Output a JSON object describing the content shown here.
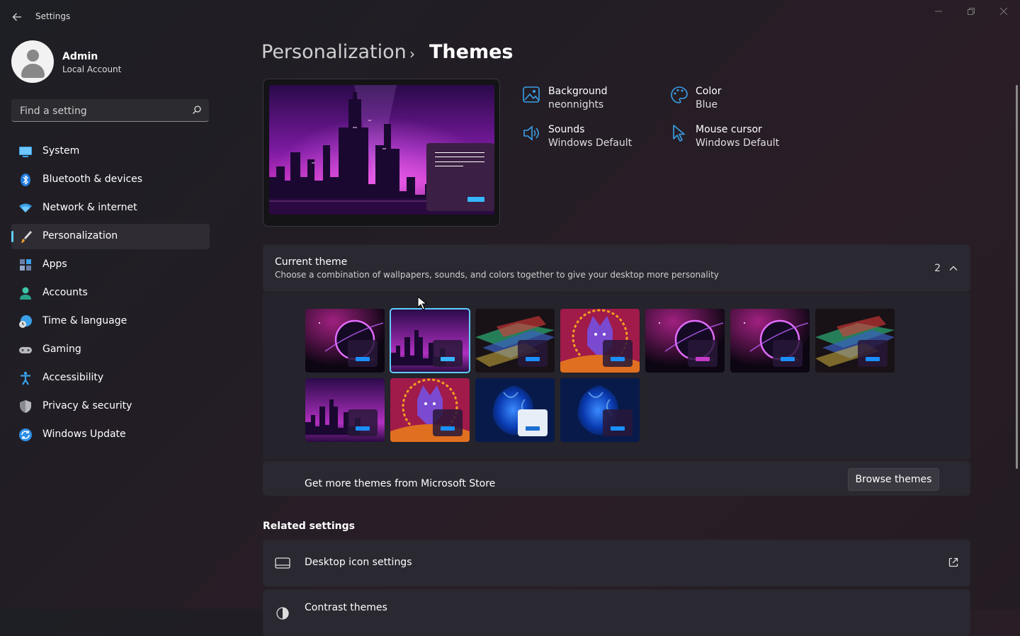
{
  "window": {
    "title": "Settings"
  },
  "user": {
    "name": "Admin",
    "account_type": "Local Account"
  },
  "search": {
    "placeholder": "Find a setting"
  },
  "sidebar": {
    "items": [
      {
        "label": "System",
        "icon": "monitor-icon"
      },
      {
        "label": "Bluetooth & devices",
        "icon": "bluetooth-icon"
      },
      {
        "label": "Network & internet",
        "icon": "wifi-icon"
      },
      {
        "label": "Personalization",
        "icon": "brush-icon",
        "active": true
      },
      {
        "label": "Apps",
        "icon": "apps-icon"
      },
      {
        "label": "Accounts",
        "icon": "person-icon"
      },
      {
        "label": "Time & language",
        "icon": "globe-clock-icon"
      },
      {
        "label": "Gaming",
        "icon": "gamepad-icon"
      },
      {
        "label": "Accessibility",
        "icon": "accessibility-icon"
      },
      {
        "label": "Privacy & security",
        "icon": "shield-icon"
      },
      {
        "label": "Windows Update",
        "icon": "update-icon"
      }
    ]
  },
  "breadcrumb": {
    "parent": "Personalization",
    "separator": "›",
    "current": "Themes"
  },
  "theme_properties": [
    {
      "label": "Background",
      "value": "neonnights",
      "icon": "picture-icon"
    },
    {
      "label": "Color",
      "value": "Blue",
      "icon": "palette-icon"
    },
    {
      "label": "Sounds",
      "value": "Windows Default",
      "icon": "speaker-icon"
    },
    {
      "label": "Mouse cursor",
      "value": "Windows Default",
      "icon": "cursor-icon"
    }
  ],
  "current_theme": {
    "title": "Current theme",
    "subtitle": "Choose a combination of wallpapers, sounds, and colors together to give your desktop more personality",
    "count": "2",
    "selected_index": 1,
    "themes": [
      {
        "wallpaper": "planet",
        "button_color": "#1a8fff"
      },
      {
        "wallpaper": "city",
        "button_color": "#35b6ff"
      },
      {
        "wallpaper": "glitch",
        "button_color": "#1a8fff"
      },
      {
        "wallpaper": "wolf",
        "button_color": "#1a8fff"
      },
      {
        "wallpaper": "planet",
        "button_color": "#c43cc8"
      },
      {
        "wallpaper": "planet",
        "button_color": "#1a8fff"
      },
      {
        "wallpaper": "glitch",
        "button_color": "#1a8fff"
      },
      {
        "wallpaper": "city",
        "button_color": "#1a8fff"
      },
      {
        "wallpaper": "wolf",
        "button_color": "#1a8fff"
      },
      {
        "wallpaper": "bloom",
        "button_color": "#1a6fd0"
      },
      {
        "wallpaper": "bloom",
        "button_color": "#1a8fff"
      }
    ]
  },
  "store": {
    "label": "Get more themes from Microsoft Store",
    "button": "Browse themes"
  },
  "related": {
    "heading": "Related settings",
    "rows": [
      {
        "label": "Desktop icon settings",
        "icon": "desktop-icon",
        "trailing": "external-link-icon"
      },
      {
        "label": "Contrast themes",
        "icon": "contrast-icon"
      }
    ]
  },
  "colors": {
    "accent": "#60cdff",
    "background": "#221d25",
    "card": "#2a2830"
  }
}
